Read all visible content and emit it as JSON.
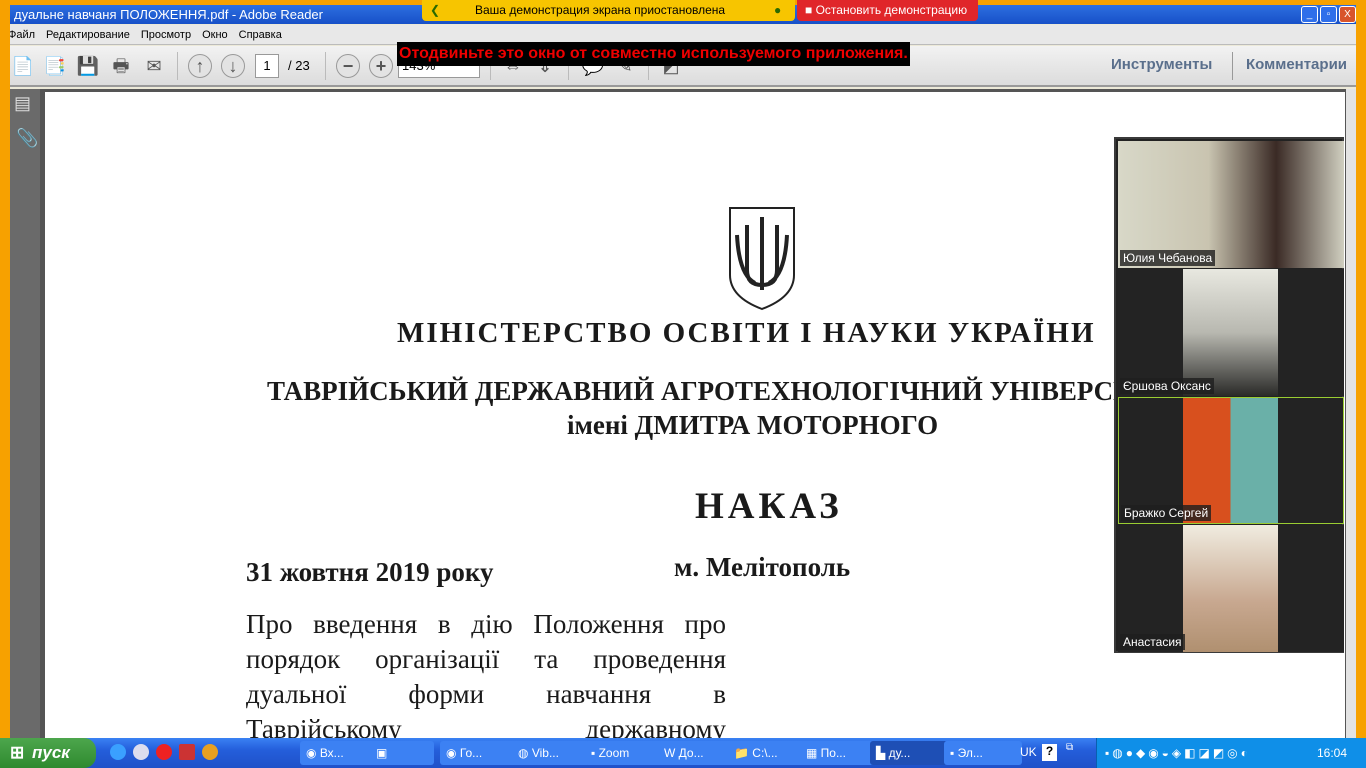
{
  "window": {
    "title": "дуальне навчаня ПОЛОЖЕННЯ.pdf - Adobe Reader",
    "minimize": "_",
    "restore": "▫",
    "close": "X"
  },
  "menu": [
    "Файл",
    "Редактирование",
    "Просмотр",
    "Окно",
    "Справка"
  ],
  "toolbar": {
    "page": "1",
    "page_total": "/ 23",
    "zoom": "143%",
    "tools": "Инструменты",
    "comments": "Комментарии"
  },
  "share": {
    "paused": "Ваша демонстрация экрана приостановлена",
    "stop": "Остановить демонстрацию",
    "warning": "Отодвиньте это окно от совместно используемого приложения."
  },
  "document": {
    "ministry": "МІНІСТЕРСТВО ОСВІТИ І НАУКИ УКРАЇНИ",
    "university": "ТАВРІЙСЬКИЙ ДЕРЖАВНИЙ АГРОТЕХНОЛОГІЧНИЙ УНІВЕРСИТЕТ",
    "named": "імені ДМИТРА МОТОРНОГО",
    "heading": "НАКАЗ",
    "date": "31 жовтня 2019 року",
    "city": "м. Мелітополь",
    "subject": [
      "Про введення в дію Положення про",
      "порядок організації та проведення",
      "дуальної форми навчання в",
      "Таврійському державному"
    ]
  },
  "participants": [
    "Юлия Чебанова",
    "Єршова Оксанс",
    "Бражко Сергей",
    "Анастасия"
  ],
  "taskbar": {
    "start": "пуск",
    "tasks": [
      "Вх...",
      "",
      "Го...",
      "Vib...",
      "Zoom",
      "До...",
      "C:\\...",
      "По...",
      "ду...",
      "Эл..."
    ],
    "lang": "UK",
    "clock": "16:04"
  },
  "colors": {
    "share_border": "#f7a100",
    "paused_bar": "#f7c500",
    "stop_bar": "#e0262a",
    "active_speaker": "#9acd32"
  }
}
